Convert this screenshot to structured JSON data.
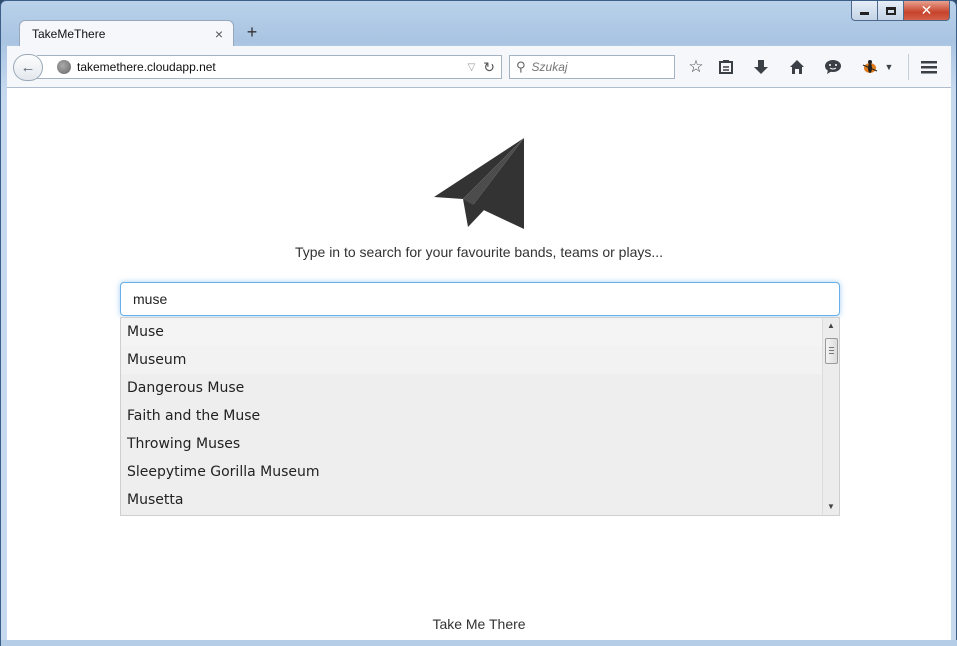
{
  "browser": {
    "tab_title": "TakeMeThere",
    "tab_close": "×",
    "new_tab": "+",
    "url": "takemethere.cloudapp.net",
    "search_placeholder": "Szukaj",
    "window_close": "✕"
  },
  "page": {
    "tagline": "Type in to search for your favourite bands, teams or plays...",
    "search_value": "muse",
    "suggestions": [
      "Muse",
      "Museum",
      "Dangerous Muse",
      "Faith and the Muse",
      "Throwing Muses",
      "Sleepytime Gorilla Museum",
      "Musetta"
    ],
    "go_label": "Take Me There"
  },
  "icons": {
    "back": "arrow-left-icon",
    "globe": "globe-icon",
    "reload": "reload-icon",
    "search": "search-icon",
    "bookmark": "star-icon",
    "reading_list": "clipboard-icon",
    "downloads": "download-arrow-icon",
    "home": "home-icon",
    "chat": "chat-bubble-icon",
    "addon": "bug-icon",
    "menu": "hamburger-icon",
    "logo": "paper-plane-icon"
  },
  "colors": {
    "focus_border": "#66afe9",
    "logo": "#333333",
    "suggestion_bg": "#eeeeee"
  }
}
